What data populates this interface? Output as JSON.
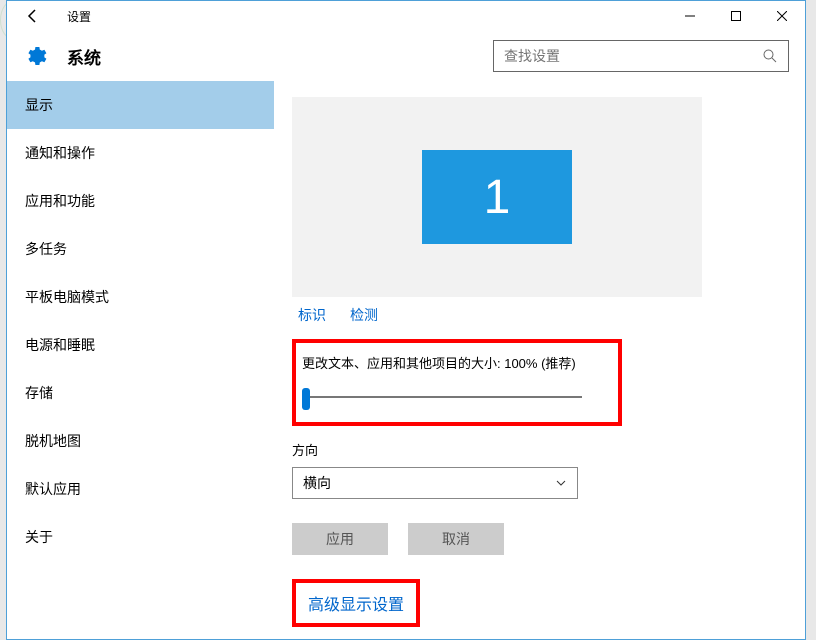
{
  "window": {
    "title": "设置"
  },
  "header": {
    "title": "系统"
  },
  "search": {
    "placeholder": "查找设置"
  },
  "sidebar": {
    "items": [
      "显示",
      "通知和操作",
      "应用和功能",
      "多任务",
      "平板电脑模式",
      "电源和睡眠",
      "存储",
      "脱机地图",
      "默认应用",
      "关于"
    ],
    "activeIndex": 0
  },
  "main": {
    "monitor_id": "1",
    "identify_label": "标识",
    "detect_label": "检测",
    "scale_label": "更改文本、应用和其他项目的大小: 100% (推荐)",
    "orientation_label": "方向",
    "orientation_value": "横向",
    "apply_label": "应用",
    "cancel_label": "取消",
    "advanced_label": "高级显示设置"
  }
}
